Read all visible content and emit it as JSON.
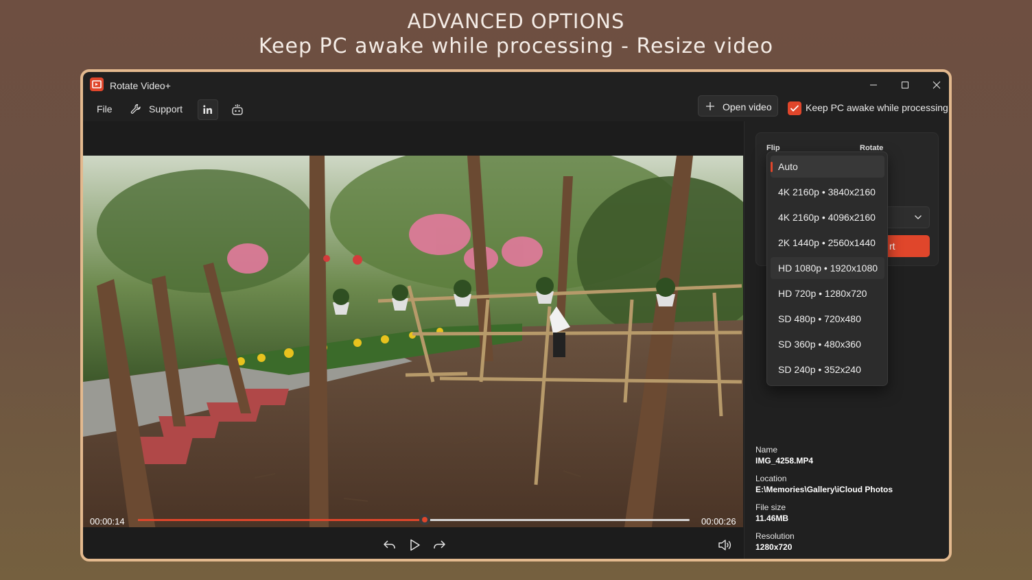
{
  "headline": {
    "line1": "ADVANCED OPTIONS",
    "line2": "Keep PC awake while processing - Resize video"
  },
  "window": {
    "title": "Rotate Video+"
  },
  "menu": {
    "file": "File",
    "support": "Support"
  },
  "toolbar": {
    "open_video": "Open video",
    "keep_awake_label": "Keep PC awake while processing",
    "keep_awake_checked": true
  },
  "player": {
    "time_current": "00:00:14",
    "time_total": "00:00:26",
    "progress": 0.52
  },
  "panel": {
    "flip_label": "Flip",
    "rotate_label": "Rotate",
    "convert_fragment": "rt"
  },
  "resolution_dropdown": {
    "options": [
      "Auto",
      "4K 2160p • 3840x2160",
      "4K 2160p • 4096x2160",
      "2K 1440p • 2560x1440",
      "HD 1080p • 1920x1080",
      "HD 720p • 1280x720",
      "SD 480p • 720x480",
      "SD 360p • 480x360",
      "SD 240p • 352x240"
    ],
    "selected": "Auto",
    "hovered": "HD 1080p • 1920x1080"
  },
  "file_info": {
    "name_label": "Name",
    "name": "IMG_4258.MP4",
    "location_label": "Location",
    "location": "E:\\Memories\\Gallery\\iCloud Photos",
    "size_label": "File size",
    "size": "11.46MB",
    "resolution_label": "Resolution",
    "resolution": "1280x720"
  },
  "colors": {
    "accent": "#e0462b",
    "frame_border": "#e3b98e",
    "window_bg": "#202020"
  }
}
